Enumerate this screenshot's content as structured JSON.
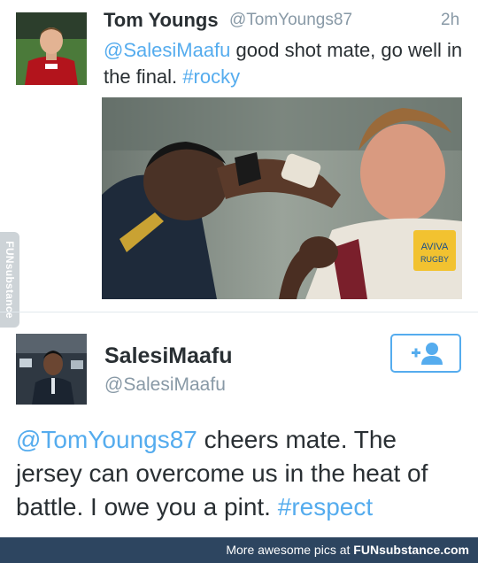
{
  "tweet1": {
    "name": "Tom Youngs",
    "handle": "@TomYoungs87",
    "time": "2h",
    "mention": "@SalesiMaafu",
    "text_body": " good shot mate, go well in the final. ",
    "hashtag": "#rocky",
    "avatar_icon": "profile-photo",
    "photo_icon": "rugby-punch-photo"
  },
  "tweet2": {
    "name": "SalesiMaafu",
    "handle": "@SalesiMaafu",
    "mention": "@TomYoungs87",
    "text_body": " cheers mate. The jersey can overcome us in the heat of battle. I owe you a pint. ",
    "hashtag": "#respect",
    "follow_icon": "add-user-icon",
    "avatar_icon": "profile-photo"
  },
  "watermark": {
    "side_text": "FUNsubstance"
  },
  "footer": {
    "text": "More awesome pics at ",
    "brand": "FUNsubstance.com"
  },
  "colors": {
    "link": "#55acee",
    "footer_bg": "#2d4560",
    "muted": "#8899a6"
  }
}
